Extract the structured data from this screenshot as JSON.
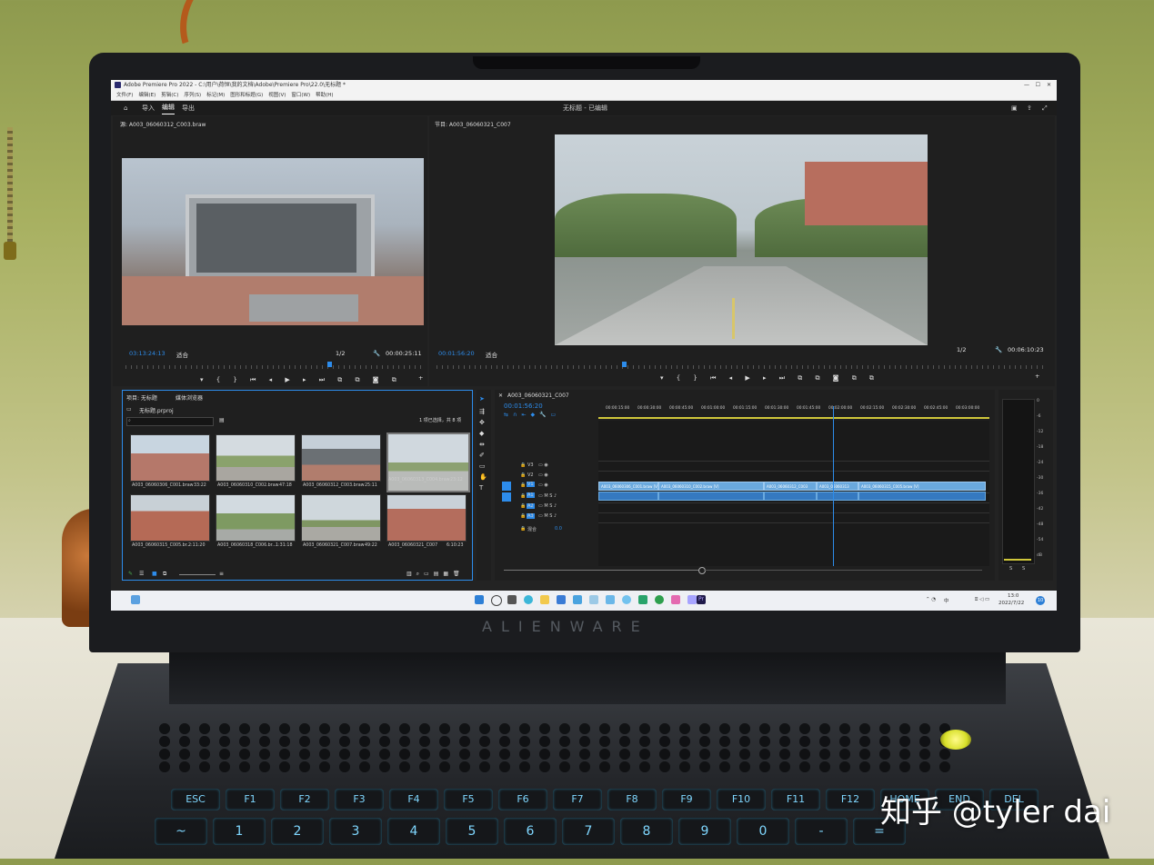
{
  "app": {
    "window_title": "Adobe Premiere Pro 2022 - C:\\用户\\荷恒\\我的文档\\Adobe\\Premiere Pro\\22.0\\无标题 *",
    "menu": [
      "文件(F)",
      "编辑(E)",
      "剪辑(C)",
      "序列(S)",
      "标记(M)",
      "图形和标题(G)",
      "视图(V)",
      "窗口(W)",
      "帮助(H)"
    ],
    "workspace_tabs": [
      "导入",
      "编辑",
      "导出"
    ],
    "active_workspace": "编辑",
    "project_title": "无标题 - 已编辑"
  },
  "source_monitor": {
    "tab": "源: A003_06060312_C003.braw",
    "timecode_in": "03:13:24:13",
    "fit": "适合",
    "resolution": "1/2",
    "duration": "00:00:25:11"
  },
  "program_monitor": {
    "tab": "节目: A003_06060321_C007",
    "timecode_in": "00:01:56:20",
    "fit": "适合",
    "resolution": "1/2",
    "duration": "00:06:10:23"
  },
  "project_panel": {
    "tabs": [
      "项目: 无标题",
      "媒体浏览器"
    ],
    "file": "无标题.prproj",
    "selection_info": "1 项已选择，共 8 项",
    "items": [
      {
        "name": "A003_06060306_C001.braw",
        "duration": "33:22"
      },
      {
        "name": "A003_06060310_C002.braw",
        "duration": "47:18"
      },
      {
        "name": "A003_06060312_C003.braw",
        "duration": "25:11"
      },
      {
        "name": "A003_06060313_C004.braw",
        "duration": "23:12"
      },
      {
        "name": "A003_06060315_C005.br...",
        "duration": "2:11:20"
      },
      {
        "name": "A003_06060318_C006.br...",
        "duration": "1:31:18"
      },
      {
        "name": "A003_06060321_C007.braw",
        "duration": "49:22"
      },
      {
        "name": "A003_06060321_C007",
        "duration": "6:10:23"
      }
    ]
  },
  "timeline": {
    "tab": "A003_06060321_C007",
    "timecode": "00:01:56:20",
    "ruler": [
      "00:00:15:00",
      "00:00:30:00",
      "00:00:45:00",
      "00:01:00:00",
      "00:01:15:00",
      "00:01:30:00",
      "00:01:45:00",
      "00:02:00:00",
      "00:02:15:00",
      "00:02:30:00",
      "00:02:45:00",
      "00:03:00:00"
    ],
    "video_tracks": [
      "V3",
      "V2",
      "V1"
    ],
    "audio_tracks": [
      "A1",
      "A2",
      "A3"
    ],
    "mix_label": "混合",
    "mix_value": "0.0",
    "clips": [
      {
        "label": "A003_06060306_C001.braw [V]"
      },
      {
        "label": "A003_06060310_C002.braw [V]"
      },
      {
        "label": "A003_06060312_C003"
      },
      {
        "label": "A003_06060313"
      },
      {
        "label": "A003_06060315_C005.braw [V]"
      }
    ]
  },
  "meter": {
    "scale": [
      "0",
      "-6",
      "-12",
      "-18",
      "-24",
      "-30",
      "-36",
      "-42",
      "-48",
      "-54",
      "dB"
    ],
    "labels": [
      "S",
      "S"
    ]
  },
  "taskbar": {
    "clock_time": "13:0",
    "clock_date": "2022/7/22",
    "lang": "中",
    "notifications": "10"
  },
  "hardware": {
    "brand": "ALIENWARE"
  },
  "keyboard": {
    "row1": [
      "ESC",
      "F1",
      "F2",
      "F3",
      "F4",
      "F5",
      "F6",
      "F7",
      "F8",
      "F9",
      "F10",
      "F11",
      "F12",
      "HOME",
      "END",
      "DEL"
    ],
    "row2": [
      "~",
      "1",
      "2",
      "3",
      "4",
      "5",
      "6",
      "7",
      "8",
      "9",
      "0",
      "-",
      "="
    ]
  },
  "watermark": "知乎 @tyler dai"
}
